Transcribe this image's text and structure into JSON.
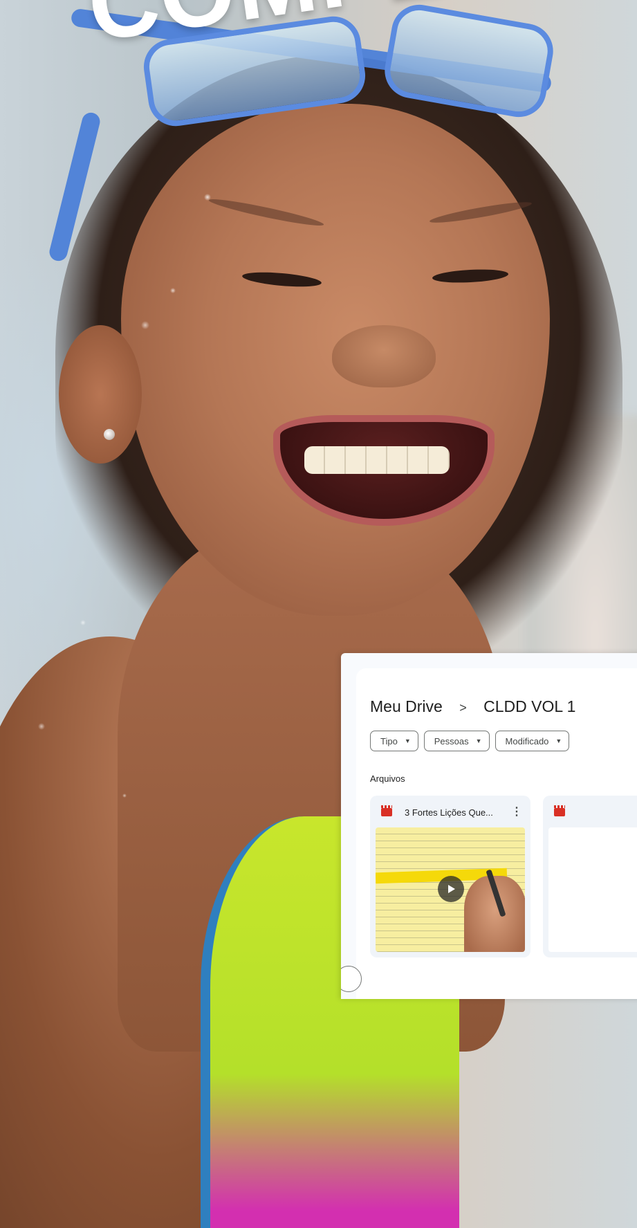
{
  "headline": {
    "text": "COMPLEM"
  },
  "drive": {
    "breadcrumb": {
      "root": "Meu Drive",
      "separator": ">",
      "folder": "CLDD VOL 1"
    },
    "filters": [
      {
        "label": "Tipo"
      },
      {
        "label": "Pessoas"
      },
      {
        "label": "Modificado"
      }
    ],
    "section_label": "Arquivos",
    "files": [
      {
        "title": "3 Fortes Lições Que...",
        "type_icon": "video-icon",
        "thumbnail": "whiteboard-video"
      }
    ]
  },
  "colors": {
    "video_icon": "#d93025",
    "swimsuit_green": "#c8e62c",
    "goggles_blue": "#4c7fd8"
  }
}
